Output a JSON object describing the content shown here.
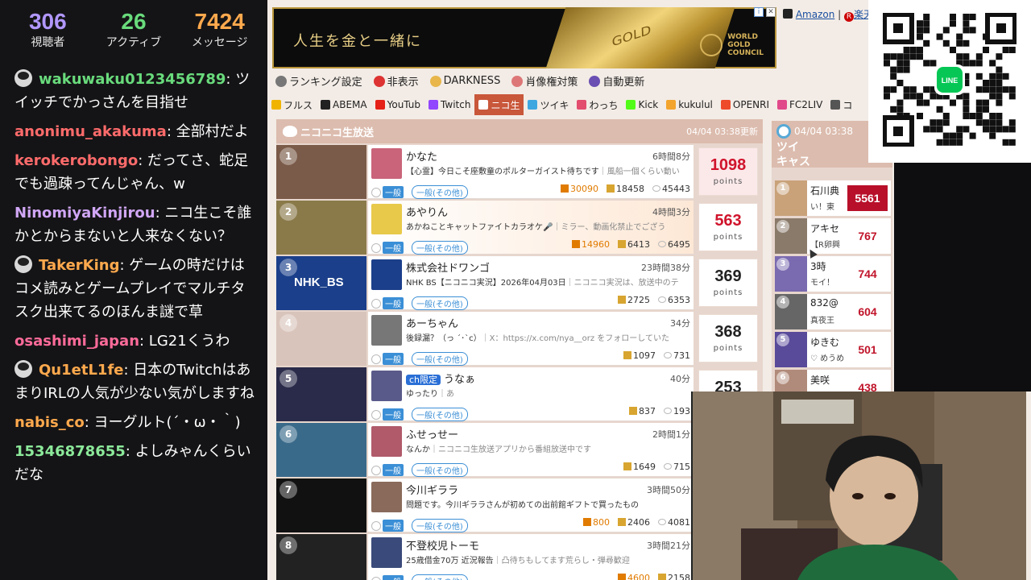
{
  "stats": [
    {
      "value": "306",
      "label": "視聴者",
      "color": "#b197fc"
    },
    {
      "value": "26",
      "label": "アクティブ",
      "color": "#69db7c"
    },
    {
      "value": "7424",
      "label": "メッセージ",
      "color": "#ffa94d"
    }
  ],
  "chat": [
    {
      "user": "wakuwaku0123456789",
      "text": ": ツイッチでかっさんを目指せ",
      "color": "#69db7c",
      "avatar": true
    },
    {
      "user": "anonimu_akakuma",
      "text": ": 全部村だよ",
      "color": "#ff6b6b",
      "avatar": false
    },
    {
      "user": "kerokerobongo",
      "text": ": だってさ、蛇足でも過疎ってんじゃん、w",
      "color": "#ff6b6b",
      "avatar": false
    },
    {
      "user": "NinomiyaKinjirou",
      "text": ": ニコ生こそ誰かとからまないと人来なくない？",
      "color": "#d0a6f5",
      "avatar": false
    },
    {
      "user": "TakerKing",
      "text": ": ゲームの時だけはコメ読みとゲームプレイでマルチタスク出来てるのほんま謎で草",
      "color": "#ffa94d",
      "avatar": true
    },
    {
      "user": "osashimi_japan",
      "text": ": LG21くうわ",
      "color": "#ff6b9a",
      "avatar": false
    },
    {
      "user": "Qu1etL1fe",
      "text": ": 日本のTwitchはあまりIRLの人気が少ない気がしますね",
      "color": "#ffa94d",
      "avatar": true
    },
    {
      "user": "nabis_co",
      "text": ": ヨーグルト(´・ω・｀)",
      "color": "#ffa94d",
      "avatar": false
    },
    {
      "user": "15346878655",
      "text": ": よしみゃんくらいだな",
      "color": "#8ce99a",
      "avatar": false
    }
  ],
  "ad": {
    "headline": "人生を金と一緒に",
    "bar_text": "GOLD",
    "brand_line1": "WORLD",
    "brand_line2": "GOLD",
    "brand_line3": "COUNCIL",
    "info": "i",
    "close": "✕",
    "amazon": "Amazon",
    "rakuten": "楽天市"
  },
  "toolbar": [
    {
      "label": "ランキング設定",
      "icon": "gear-icon",
      "color": "#777"
    },
    {
      "label": "非表示",
      "icon": "forbidden-icon",
      "color": "#d33"
    },
    {
      "label": "DARKNESS",
      "icon": "moon-icon",
      "color": "#e8b64a"
    },
    {
      "label": "肖像権対策",
      "icon": "portrait-icon",
      "color": "#d77"
    },
    {
      "label": "自動更新",
      "icon": "tv-icon",
      "color": "#6b4fb3"
    }
  ],
  "tabs": [
    {
      "label": "フルス",
      "color": "#f0b400",
      "active": false
    },
    {
      "label": "ABEMA",
      "color": "#222",
      "active": false
    },
    {
      "label": "YouTub",
      "color": "#e62117",
      "active": false
    },
    {
      "label": "Twitch",
      "color": "#9146ff",
      "active": false
    },
    {
      "label": "ニコ生",
      "color": "#fff",
      "active": true
    },
    {
      "label": "ツイキ",
      "color": "#3fa7e0",
      "active": false
    },
    {
      "label": "わっち",
      "color": "#e34d6e",
      "active": false
    },
    {
      "label": "Kick",
      "color": "#53fc18",
      "active": false
    },
    {
      "label": "kukulul",
      "color": "#f3a42d",
      "active": false
    },
    {
      "label": "OPENRI",
      "color": "#ee4b2b",
      "active": false
    },
    {
      "label": "FC2LIV",
      "color": "#e14a8a",
      "active": false
    },
    {
      "label": "コ",
      "color": "#555",
      "active": false
    }
  ],
  "ranking": {
    "title": "ニコニコ生放送",
    "updated": "04/04 03:38更新",
    "unit": "points",
    "rows": [
      {
        "rank": "1",
        "name": "かなた",
        "desc_main": "【心霊】今日こそ座敷童のポルターガイスト待ちです",
        "desc_rest": "｜風船一個くらい動い",
        "dur": "6時間8分",
        "gift": "30090",
        "people": "18458",
        "comments": "45443",
        "points": "1098",
        "thumb": "#7a5a48",
        "av": "#c9647a"
      },
      {
        "rank": "2",
        "name": "あやりん",
        "desc_main": "あかねことキャットファイトカラオケ🎤",
        "desc_rest": "｜ミラー、動画化禁止でござう",
        "dur": "4時間3分",
        "gift": "14960",
        "people": "6413",
        "comments": "6495",
        "points": "563",
        "thumb": "#8a7a4a",
        "av": "#e8c94a"
      },
      {
        "rank": "3",
        "name": "株式会社ドワンゴ",
        "desc_main": "NHK BS【ニコニコ実況】2026年04月03日",
        "desc_rest": "｜ニコニコ実況は、放送中のテ",
        "dur": "23時間38分",
        "gift": "",
        "people": "2725",
        "comments": "6353",
        "points": "369",
        "thumb": "#1b3f8a",
        "av": "#1b3f8a",
        "thumb_text": "NHK_BS"
      },
      {
        "rank": "4",
        "name": "あーちゃん",
        "desc_main": "後録漏？（っ ´･`c）",
        "desc_rest": "｜X：https://x.com/nya__orz をフォローしていた",
        "dur": "34分",
        "gift": "",
        "people": "1097",
        "comments": "731",
        "points": "368",
        "thumb": "#d9c4bb",
        "av": "#777"
      },
      {
        "rank": "5",
        "name": "うなぁ",
        "badge": "ch限定",
        "desc_main": "ゆったり",
        "desc_rest": "｜あ",
        "dur": "40分",
        "gift": "",
        "people": "837",
        "comments": "193",
        "points": "253",
        "thumb": "#2a2a4a",
        "av": "#5a5a8a"
      },
      {
        "rank": "6",
        "name": "ふせっせー",
        "desc_main": "なんか",
        "desc_rest": "｜ニコニコ生放送アプリから番組放送中です",
        "dur": "2時間1分",
        "gift": "",
        "people": "1649",
        "comments": "715",
        "points": "",
        "thumb": "#3a6a8a",
        "av": "#b05a6a"
      },
      {
        "rank": "7",
        "name": "今川ギララ",
        "desc_main": "問題です。今川ギララさんが初めての出前館ギフトで買ったもの",
        "desc_rest": "",
        "dur": "3時間50分",
        "gift": "800",
        "people": "2406",
        "comments": "4081",
        "points": "",
        "thumb": "#111",
        "av": "#8a6a5a"
      },
      {
        "rank": "8",
        "name": "不登校児トーモ",
        "desc_main": "25歳借金70万 近況報告",
        "desc_rest": "｜凸待ちもしてます荒らし・弾尋歓迎",
        "dur": "3時間21分",
        "gift": "4600",
        "people": "2158",
        "comments": "",
        "points": "",
        "thumb": "#222",
        "av": "#3a4a7a"
      }
    ]
  },
  "twicas": {
    "updated": "04/04 03:38",
    "title_line1": "ツイ",
    "title_line2": "キャス",
    "rows": [
      {
        "rank": "1",
        "name": "石川典",
        "sub": "い！東",
        "score": "5561",
        "photo": "#c9a27a"
      },
      {
        "rank": "2",
        "name": "アキセ",
        "sub": "【R卵興",
        "score": "767",
        "photo": "#8a7a6a"
      },
      {
        "rank": "3",
        "name": "3時",
        "sub": "モイ！",
        "score": "744",
        "photo": "#7a6ab0"
      },
      {
        "rank": "4",
        "name": "832@",
        "sub": "真夜王",
        "score": "604",
        "photo": "#666"
      },
      {
        "rank": "5",
        "name": "ゆきむ",
        "sub": "♡ めうめ",
        "score": "501",
        "photo": "#5a4a9a"
      },
      {
        "rank": "6",
        "name": "美咲",
        "sub": "",
        "score": "438",
        "photo": "#b08a7a"
      }
    ]
  },
  "qr": {
    "badge": "LINE"
  }
}
